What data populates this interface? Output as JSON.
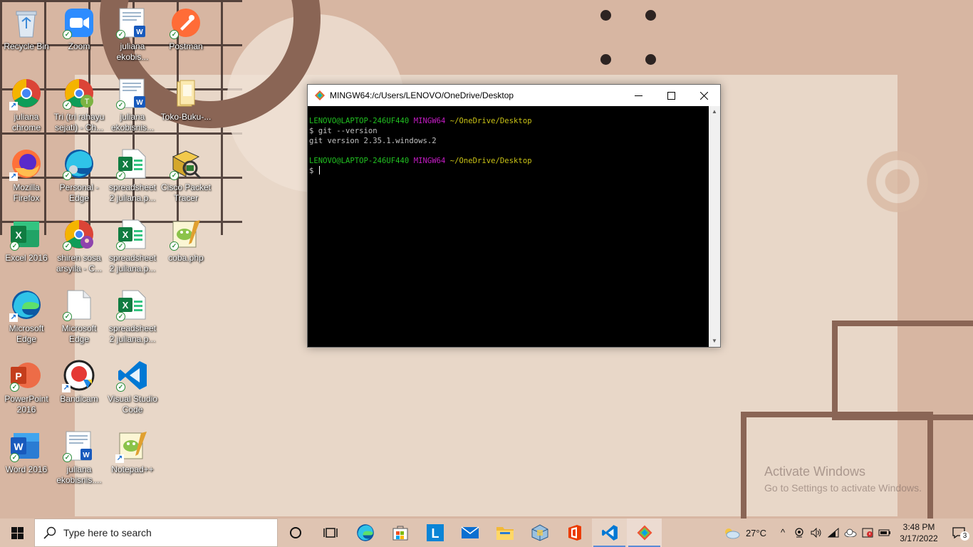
{
  "desktop": {
    "icons": [
      {
        "label": "Recycle Bin"
      },
      {
        "label": "Zoom"
      },
      {
        "label": "juliana ekobis..."
      },
      {
        "label": "Postman"
      },
      {
        "label": "juliana chrome"
      },
      {
        "label": "Tri (tri rahayu sejati) - Ch..."
      },
      {
        "label": "juliana ekobisnis..."
      },
      {
        "label": "Toko-Buku-..."
      },
      {
        "label": "Mozilla Firefox"
      },
      {
        "label": "Personal - Edge"
      },
      {
        "label": "spreadsheet 2 juliana.p..."
      },
      {
        "label": "Cisco Packet Tracer"
      },
      {
        "label": "Excel 2016"
      },
      {
        "label": "shiren sosa arsyila - C..."
      },
      {
        "label": "spreadsheet 2 juliana.p..."
      },
      {
        "label": "coba.php"
      },
      {
        "label": "Microsoft Edge"
      },
      {
        "label": "Microsoft Edge"
      },
      {
        "label": "spreadsheet 2 juliana.p..."
      },
      {
        "label": "PowerPoint 2016"
      },
      {
        "label": "Bandicam"
      },
      {
        "label": "Visual Studio Code"
      },
      {
        "label": "Word 2016"
      },
      {
        "label": "juliana ekobisnis...."
      },
      {
        "label": "Notepad++"
      }
    ],
    "watermark": {
      "line1": "Activate Windows",
      "line2": "Go to Settings to activate Windows."
    }
  },
  "terminal": {
    "title": "MINGW64:/c/Users/LENOVO/OneDrive/Desktop",
    "prompt_user": "LENOVO@LAPTOP-246UF440",
    "prompt_env": "MINGW64",
    "prompt_path": "~/OneDrive/Desktop",
    "cmd1": "$ git --version",
    "out1": "git version 2.35.1.windows.2",
    "prompt_symbol": "$ "
  },
  "taskbar": {
    "search_placeholder": "Type here to search",
    "weather": "27°C",
    "time": "3:48 PM",
    "date": "3/17/2022",
    "notifications": "3"
  }
}
